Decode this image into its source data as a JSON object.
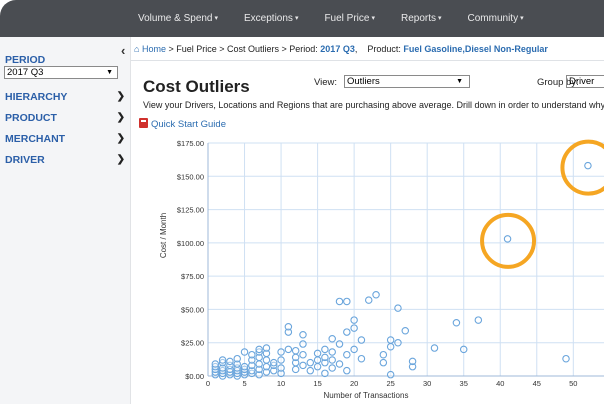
{
  "nav": {
    "items": [
      {
        "label": "Volume & Spend"
      },
      {
        "label": "Exceptions"
      },
      {
        "label": "Fuel Price"
      },
      {
        "label": "Reports"
      },
      {
        "label": "Community"
      }
    ]
  },
  "sidebar": {
    "period_label": "PERIOD",
    "period_value": "2017 Q3",
    "items": [
      {
        "label": "HIERARCHY"
      },
      {
        "label": "PRODUCT"
      },
      {
        "label": "MERCHANT"
      },
      {
        "label": "DRIVER"
      }
    ]
  },
  "breadcrumb": {
    "home": "Home",
    "path": " > Fuel Price > Cost Outliers > Period: ",
    "period": "2017 Q3",
    "product_label": ",    Product: ",
    "product": "Fuel Gasoline,Diesel Non-Regular"
  },
  "page": {
    "title": "Cost Outliers",
    "view_label": "View:",
    "view_value": "Outliers",
    "group_label": "Group by:",
    "group_value": "Driver",
    "description": "View your Drivers, Locations and Regions that are purchasing above average. Drill down in order to understand why.",
    "guide_link": "Quick Start Guide"
  },
  "colors": {
    "point": "#6aa5dc",
    "highlight": "#f5a623",
    "grid": "#cfe0f3"
  },
  "chart_data": {
    "type": "scatter",
    "xlabel": "Number of Transactions",
    "ylabel": "Cost / Month",
    "xlim": [
      0,
      55
    ],
    "ylim": [
      0,
      175
    ],
    "x_ticks": [
      0,
      5,
      10,
      15,
      20,
      25,
      30,
      35,
      40,
      45,
      50
    ],
    "y_ticks": [
      "$0.00",
      "$25.00",
      "$50.00",
      "$75.00",
      "$100.00",
      "$125.00",
      "$150.00",
      "$175.00"
    ],
    "grid": true,
    "highlighted": [
      [
        41,
        103
      ],
      [
        52,
        158
      ]
    ],
    "points": [
      [
        1,
        1
      ],
      [
        1,
        3
      ],
      [
        1,
        5
      ],
      [
        1,
        7
      ],
      [
        1,
        9
      ],
      [
        2,
        0
      ],
      [
        2,
        2
      ],
      [
        2,
        4
      ],
      [
        2,
        6
      ],
      [
        2,
        10
      ],
      [
        2,
        12
      ],
      [
        3,
        1
      ],
      [
        3,
        3
      ],
      [
        3,
        5
      ],
      [
        3,
        8
      ],
      [
        3,
        11
      ],
      [
        4,
        0
      ],
      [
        4,
        2
      ],
      [
        4,
        4
      ],
      [
        4,
        6
      ],
      [
        4,
        9
      ],
      [
        4,
        13
      ],
      [
        5,
        1
      ],
      [
        5,
        3
      ],
      [
        5,
        5
      ],
      [
        5,
        7
      ],
      [
        5,
        18
      ],
      [
        6,
        2
      ],
      [
        6,
        4
      ],
      [
        6,
        8
      ],
      [
        6,
        12
      ],
      [
        6,
        16
      ],
      [
        7,
        1
      ],
      [
        7,
        5
      ],
      [
        7,
        9
      ],
      [
        7,
        14
      ],
      [
        7,
        18
      ],
      [
        7,
        20
      ],
      [
        8,
        3
      ],
      [
        8,
        7
      ],
      [
        8,
        12
      ],
      [
        8,
        17
      ],
      [
        8,
        21
      ],
      [
        9,
        4
      ],
      [
        9,
        8
      ],
      [
        9,
        10
      ],
      [
        10,
        2
      ],
      [
        10,
        6
      ],
      [
        10,
        12
      ],
      [
        10,
        18
      ],
      [
        11,
        20
      ],
      [
        11,
        33
      ],
      [
        11,
        37
      ],
      [
        12,
        5
      ],
      [
        12,
        10
      ],
      [
        12,
        14
      ],
      [
        12,
        19
      ],
      [
        13,
        8
      ],
      [
        13,
        16
      ],
      [
        13,
        24
      ],
      [
        13,
        31
      ],
      [
        14,
        4
      ],
      [
        14,
        10
      ],
      [
        15,
        7
      ],
      [
        15,
        12
      ],
      [
        15,
        17
      ],
      [
        16,
        2
      ],
      [
        16,
        10
      ],
      [
        16,
        14
      ],
      [
        16,
        20
      ],
      [
        17,
        6
      ],
      [
        17,
        12
      ],
      [
        17,
        18
      ],
      [
        17,
        28
      ],
      [
        18,
        56
      ],
      [
        18,
        24
      ],
      [
        18,
        9
      ],
      [
        19,
        4
      ],
      [
        19,
        16
      ],
      [
        19,
        33
      ],
      [
        19,
        56
      ],
      [
        20,
        20
      ],
      [
        20,
        36
      ],
      [
        20,
        42
      ],
      [
        21,
        13
      ],
      [
        21,
        27
      ],
      [
        22,
        57
      ],
      [
        23,
        61
      ],
      [
        24,
        10
      ],
      [
        24,
        16
      ],
      [
        25,
        1
      ],
      [
        25,
        22
      ],
      [
        25,
        27
      ],
      [
        26,
        25
      ],
      [
        26,
        51
      ],
      [
        27,
        34
      ],
      [
        28,
        7
      ],
      [
        28,
        11
      ],
      [
        31,
        21
      ],
      [
        34,
        40
      ],
      [
        35,
        20
      ],
      [
        37,
        42
      ],
      [
        49,
        13
      ]
    ]
  }
}
